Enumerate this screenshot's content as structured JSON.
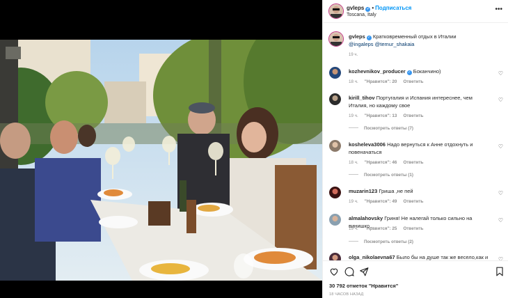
{
  "header": {
    "username": "gvleps",
    "follow_label": "Подписаться",
    "location": "Toscana, Italy",
    "more_icon": "ellipsis-icon"
  },
  "caption": {
    "username": "gvleps",
    "text": "Кратковременный отдых в Италии",
    "mention1": "@ingaleps",
    "mention2": "@temur_shakaia",
    "time": "19 ч."
  },
  "comments": [
    {
      "user": "kozhevnikov_producer",
      "verified": true,
      "text": "Боканчино)",
      "time": "18 ч.",
      "likes": "\"Нравится\": 20",
      "reply": "Ответить",
      "view": ""
    },
    {
      "user": "kirill_tihov",
      "verified": false,
      "text": "Португалия и Испания интереснее, чем Италия, но каждому свое",
      "time": "19 ч.",
      "likes": "\"Нравится\": 13",
      "reply": "Ответить",
      "view": "Посмотреть ответы (7)"
    },
    {
      "user": "kosheleva3006",
      "verified": false,
      "text": "Надо вернуться к Анне отдохнуть и повеначаться",
      "time": "18 ч.",
      "likes": "\"Нравится\": 46",
      "reply": "Ответить",
      "view": "Посмотреть ответы (1)"
    },
    {
      "user": "muzarin123",
      "verified": false,
      "text": "Гриша ,не пей",
      "time": "19 ч.",
      "likes": "\"Нравится\": 49",
      "reply": "Ответить",
      "view": ""
    },
    {
      "user": "almalahovsky",
      "verified": false,
      "text": "Гриня! Не налегай только сильно на винишко…",
      "time": "19 ч.",
      "likes": "\"Нравится\": 25",
      "reply": "Ответить",
      "view": "Посмотреть ответы (2)"
    },
    {
      "user": "olga_nikolaevna67",
      "verified": false,
      "text": "Было бы на душе так же весело,как и на",
      "time": "",
      "likes": "",
      "reply": "",
      "view": ""
    }
  ],
  "footer": {
    "likes": "30 792 отметок \"Нравится\"",
    "ago": "18 ЧАСОВ НАЗАД",
    "icons": [
      "heart-icon",
      "comment-icon",
      "share-icon",
      "bookmark-icon"
    ]
  },
  "colors": {
    "link": "#00376b",
    "follow": "#0095f6",
    "verified": "#3897f0",
    "muted": "#8e8e8e"
  }
}
